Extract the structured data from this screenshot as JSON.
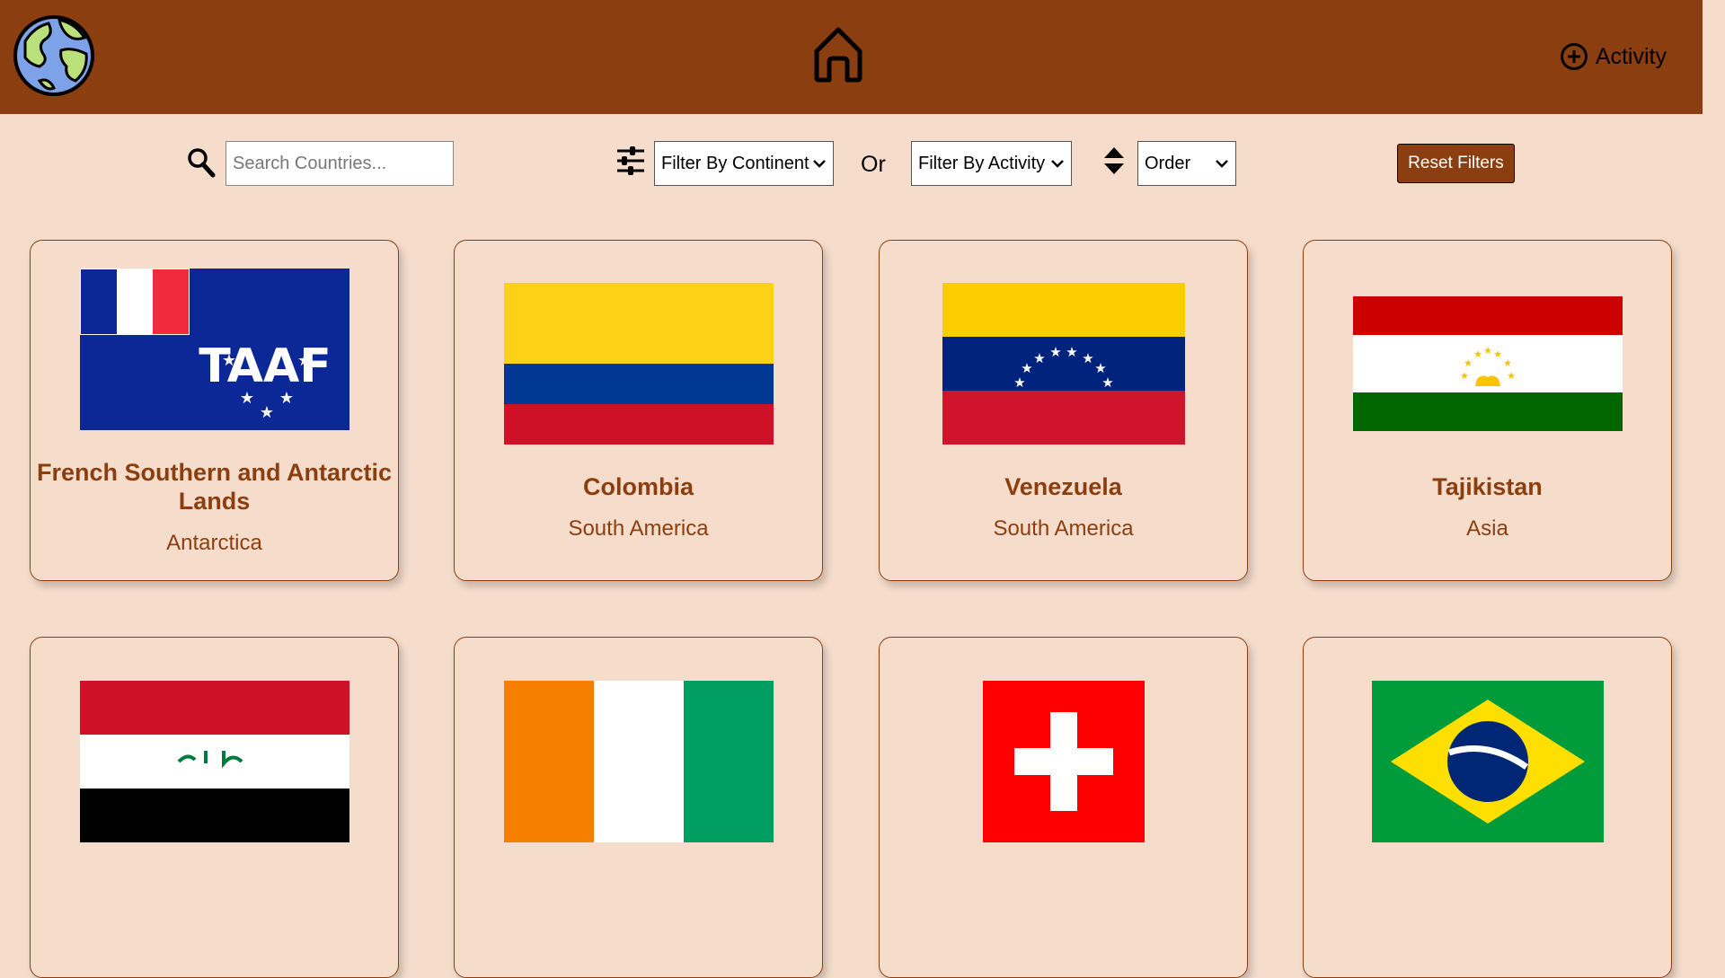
{
  "header": {
    "logo_icon": "globe-icon",
    "home_icon": "home-icon",
    "activity_label": "Activity",
    "activity_icon": "plus-circle-icon"
  },
  "toolbar": {
    "search_placeholder": "Search Countries...",
    "continent_filter": "Filter By Continent",
    "or_label": "Or",
    "activity_filter": "Filter By Activity",
    "order_select": "Order",
    "reset_label": "Reset Filters"
  },
  "countries": [
    {
      "name": "French Southern and Antarctic Lands",
      "continent": "Antarctica"
    },
    {
      "name": "Colombia",
      "continent": "South America"
    },
    {
      "name": "Venezuela",
      "continent": "South America"
    },
    {
      "name": "Tajikistan",
      "continent": "Asia"
    },
    {
      "name": "",
      "continent": ""
    },
    {
      "name": "",
      "continent": ""
    },
    {
      "name": "",
      "continent": ""
    },
    {
      "name": "",
      "continent": ""
    }
  ],
  "colors": {
    "brand": "#8b3f10",
    "background": "#f5dccb"
  }
}
